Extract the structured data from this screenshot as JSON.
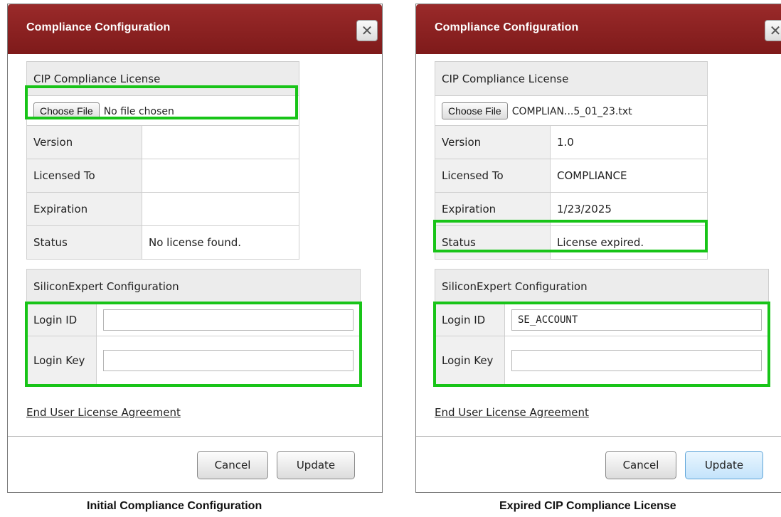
{
  "dialogs": [
    {
      "title": "Compliance Configuration",
      "close_glyph": "✕",
      "cip_header": "CIP Compliance License",
      "choose_file_label": "Choose File",
      "file_name": "No file chosen",
      "rows": [
        {
          "label": "Version",
          "value": ""
        },
        {
          "label": "Licensed To",
          "value": ""
        },
        {
          "label": "Expiration",
          "value": ""
        },
        {
          "label": "Status",
          "value": "No license found."
        }
      ],
      "se_header": "SiliconExpert Configuration",
      "login_id_label": "Login ID",
      "login_id_value": "",
      "login_key_label": "Login Key",
      "login_key_value": "",
      "eula_link": "End User License Agreement",
      "cancel_label": "Cancel",
      "update_label": "Update",
      "caption": "Initial Compliance Configuration"
    },
    {
      "title": "Compliance Configuration",
      "close_glyph": "✕",
      "cip_header": "CIP Compliance License",
      "choose_file_label": "Choose File",
      "file_name": "COMPLIAN...5_01_23.txt",
      "rows": [
        {
          "label": "Version",
          "value": "1.0"
        },
        {
          "label": "Licensed To",
          "value": "COMPLIANCE"
        },
        {
          "label": "Expiration",
          "value": "1/23/2025"
        },
        {
          "label": "Status",
          "value": "License expired."
        }
      ],
      "se_header": "SiliconExpert Configuration",
      "login_id_label": "Login ID",
      "login_id_value": "SE_ACCOUNT",
      "login_key_label": "Login Key",
      "login_key_value": "",
      "eula_link": "End User License Agreement",
      "cancel_label": "Cancel",
      "update_label": "Update",
      "caption": "Expired CIP Compliance License"
    }
  ],
  "colors": {
    "titlebar": "#8b2222",
    "highlight": "#18c418",
    "update_focus": "#c4e3fb"
  }
}
